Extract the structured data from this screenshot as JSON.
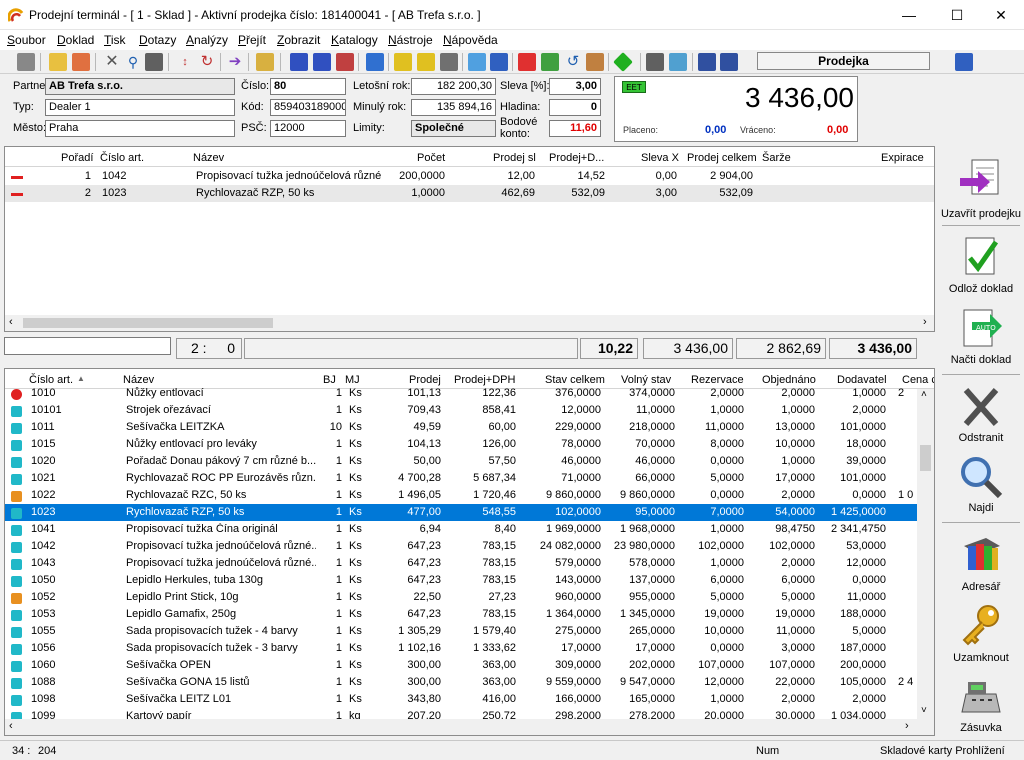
{
  "window": {
    "title": "Prodejní terminál - [ 1 - Sklad ] - Aktivní prodejka číslo: 181400041 - [ AB Trefa s.r.o. ]",
    "minimize": "—",
    "maximize": "☐",
    "close": "✕"
  },
  "menu": [
    "Soubor",
    "Doklad",
    "Tisk",
    "Dotazy",
    "Analýzy",
    "Přejít",
    "Zobrazit",
    "Katalogy",
    "Nástroje",
    "Nápověda"
  ],
  "mode": "Prodejka",
  "header": {
    "partner_label": "Partner",
    "partner": "AB Trefa s.r.o.",
    "typ_label": "Typ:",
    "typ": "Dealer 1",
    "mesto_label": "Město:",
    "mesto": "Praha",
    "cislo_label": "Číslo:",
    "cislo": "80",
    "kod_label": "Kód:",
    "kod": "859403189000",
    "psc_label": "PSČ:",
    "psc": "12000",
    "letos_label": "Letošní rok:",
    "letos": "182 200,30",
    "minuly_label": "Minulý rok:",
    "minuly": "135 894,16",
    "limity_label": "Limity:",
    "limity": "Společné",
    "sleva_label": "Sleva [%]:",
    "sleva": "3,00",
    "hladina_label": "Hladina:",
    "hladina": "0",
    "bodove_label": "Bodové konto:",
    "bodove": "11,60"
  },
  "total": {
    "eet": "EET",
    "amount": "3 436,00",
    "placeno_label": "Placeno:",
    "placeno": "0,00",
    "vraceno_label": "Vráceno:",
    "vraceno": "0,00"
  },
  "grid1": {
    "columns": [
      "Pořadí",
      "Číslo art.",
      "Název",
      "Počet",
      "Prodej sl",
      "Prodej+D...",
      "Sleva X",
      "Prodej celkem",
      "Šarže",
      "Expirace"
    ],
    "rows": [
      [
        "1",
        "1042",
        "Propisovací tužka jednoúčelová různé...",
        "200,0000",
        "12,00",
        "14,52",
        "0,00",
        "2 904,00"
      ],
      [
        "2",
        "1023",
        "Rychlovazač RZP, 50 ks",
        "1,0000",
        "462,69",
        "532,09",
        "3,00",
        "532,09"
      ]
    ]
  },
  "summary": {
    "count": "2 :",
    "zero": "0",
    "s1": "10,22",
    "s2": "3 436,00",
    "s3": "2 862,69",
    "s4": "3 436,00"
  },
  "grid2": {
    "columns": [
      "Číslo art.",
      "Název",
      "BJ",
      "MJ",
      "Prodej",
      "Prodej+DPH",
      "Stav celkem",
      "Volný stav",
      "Rezervace",
      "Objednáno",
      "Dodavatel",
      "Cena c"
    ],
    "rows": [
      [
        "1010",
        "Nůžky entlovací",
        "1",
        "Ks",
        "101,13",
        "122,36",
        "376,0000",
        "374,0000",
        "2,0000",
        "2,0000",
        "1,0000",
        "2"
      ],
      [
        "10101",
        "Strojek ořezávací",
        "1",
        "Ks",
        "709,43",
        "858,41",
        "12,0000",
        "11,0000",
        "1,0000",
        "1,0000",
        "2,0000",
        ""
      ],
      [
        "1011",
        "Sešívačka LEITZKA",
        "10",
        "Ks",
        "49,59",
        "60,00",
        "229,0000",
        "218,0000",
        "11,0000",
        "13,0000",
        "101,0000",
        ""
      ],
      [
        "1015",
        "Nůžky entlovací pro leváky",
        "1",
        "Ks",
        "104,13",
        "126,00",
        "78,0000",
        "70,0000",
        "8,0000",
        "10,0000",
        "18,0000",
        ""
      ],
      [
        "1020",
        "Pořadač Donau pákový 7 cm různé b...",
        "1",
        "Ks",
        "50,00",
        "57,50",
        "46,0000",
        "46,0000",
        "0,0000",
        "1,0000",
        "39,0000",
        ""
      ],
      [
        "1021",
        "Rychlovazač ROC PP Eurozávěs různ...",
        "1",
        "Ks",
        "4 700,28",
        "5 687,34",
        "71,0000",
        "66,0000",
        "5,0000",
        "17,0000",
        "101,0000",
        ""
      ],
      [
        "1022",
        "Rychlovazač RZC, 50 ks",
        "1",
        "Ks",
        "1 496,05",
        "1 720,46",
        "9 860,0000",
        "9 860,0000",
        "0,0000",
        "2,0000",
        "0,0000",
        "1 0"
      ],
      [
        "1023",
        "Rychlovazač RZP, 50 ks",
        "1",
        "Ks",
        "477,00",
        "548,55",
        "102,0000",
        "95,0000",
        "7,0000",
        "54,0000",
        "1 425,0000",
        ""
      ],
      [
        "1041",
        "Propisovací tužka Čína originál",
        "1",
        "Ks",
        "6,94",
        "8,40",
        "1 969,0000",
        "1 968,0000",
        "1,0000",
        "98,4750",
        "2 341,4750",
        ""
      ],
      [
        "1042",
        "Propisovací tužka jednoúčelová různé...",
        "1",
        "Ks",
        "647,23",
        "783,15",
        "24 082,0000",
        "23 980,0000",
        "102,0000",
        "102,0000",
        "53,0000",
        ""
      ],
      [
        "1043",
        "Propisovací tužka jednoúčelová různé...",
        "1",
        "Ks",
        "647,23",
        "783,15",
        "579,0000",
        "578,0000",
        "1,0000",
        "2,0000",
        "12,0000",
        ""
      ],
      [
        "1050",
        "Lepidlo Herkules, tuba 130g",
        "1",
        "Ks",
        "647,23",
        "783,15",
        "143,0000",
        "137,0000",
        "6,0000",
        "6,0000",
        "0,0000",
        ""
      ],
      [
        "1052",
        "Lepidlo Print Stick, 10g",
        "1",
        "Ks",
        "22,50",
        "27,23",
        "960,0000",
        "955,0000",
        "5,0000",
        "5,0000",
        "11,0000",
        ""
      ],
      [
        "1053",
        "Lepidlo Gamafix, 250g",
        "1",
        "Ks",
        "647,23",
        "783,15",
        "1 364,0000",
        "1 345,0000",
        "19,0000",
        "19,0000",
        "188,0000",
        ""
      ],
      [
        "1055",
        "Sada propisovacích tužek - 4 barvy",
        "1",
        "Ks",
        "1 305,29",
        "1 579,40",
        "275,0000",
        "265,0000",
        "10,0000",
        "11,0000",
        "5,0000",
        ""
      ],
      [
        "1056",
        "Sada propisovacích tužek - 3 barvy",
        "1",
        "Ks",
        "1 102,16",
        "1 333,62",
        "17,0000",
        "17,0000",
        "0,0000",
        "3,0000",
        "187,0000",
        ""
      ],
      [
        "1060",
        "Sešívačka OPEN",
        "1",
        "Ks",
        "300,00",
        "363,00",
        "309,0000",
        "202,0000",
        "107,0000",
        "107,0000",
        "200,0000",
        ""
      ],
      [
        "1088",
        "Sešívačka GONA 15 listů",
        "1",
        "Ks",
        "300,00",
        "363,00",
        "9 559,0000",
        "9 547,0000",
        "12,0000",
        "22,0000",
        "105,0000",
        "2 4"
      ],
      [
        "1098",
        "Sešívačka LEITZ L01",
        "1",
        "Ks",
        "343,80",
        "416,00",
        "166,0000",
        "165,0000",
        "1,0000",
        "2,0000",
        "2,0000",
        ""
      ],
      [
        "1099",
        "Kartový papír",
        "1",
        "kg",
        "207,20",
        "250,72",
        "298,2000",
        "278,2000",
        "20,0000",
        "30,0000",
        "1 034,0000",
        ""
      ]
    ],
    "row_icons": [
      "red",
      "cyan",
      "cyan",
      "cyan",
      "cyan",
      "cyan",
      "orange",
      "cyan",
      "cyan",
      "cyan",
      "cyan",
      "cyan",
      "orange",
      "cyan",
      "cyan",
      "cyan",
      "cyan",
      "cyan",
      "cyan",
      "cyan"
    ]
  },
  "sidebar": [
    "Uzavřít prodejku",
    "Odlož doklad",
    "Načti doklad",
    "Odstranit",
    "Najdi",
    "Adresář",
    "Uzamknout",
    "Zásuvka"
  ],
  "status": {
    "pos": "34 :",
    "count": "204",
    "num": "Num",
    "right": "Skladové karty Prohlížení"
  }
}
